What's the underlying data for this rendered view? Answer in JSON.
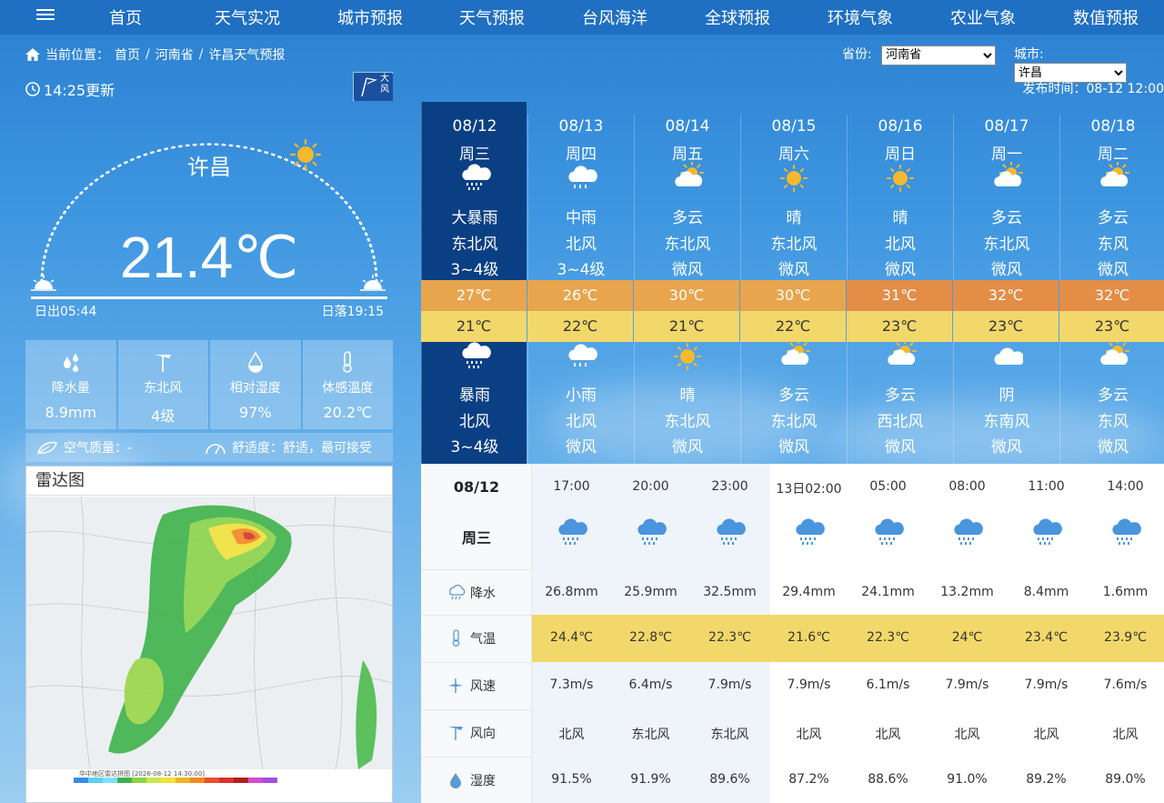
{
  "nav": {
    "items": [
      "首页",
      "天气实况",
      "城市预报",
      "天气预报",
      "台风海洋",
      "全球预报",
      "环境气象",
      "农业气象",
      "数值预报"
    ]
  },
  "breadcrumb": {
    "label": "当前位置：",
    "items": [
      "首页",
      "河南省",
      "许昌天气预报"
    ]
  },
  "selectors": {
    "province_label": "省份:",
    "province_value": "河南省",
    "city_label": "城市:",
    "city_value": "许昌"
  },
  "update_time": "14:25更新",
  "publish_time": "发布时间：08-12 12:00",
  "warning_badge": "大风",
  "current": {
    "city": "许昌",
    "temperature": "21.4℃",
    "sunrise": "日出05:44",
    "sunset": "日落19:15",
    "stats": [
      {
        "icon": "raindrop-icon",
        "label": "降水量",
        "value": "8.9mm"
      },
      {
        "icon": "wind-icon",
        "label": "东北风",
        "value": "4级"
      },
      {
        "icon": "humidity-icon",
        "label": "相对湿度",
        "value": "97%"
      },
      {
        "icon": "thermometer-icon",
        "label": "体感温度",
        "value": "20.2℃"
      }
    ],
    "air_quality": "空气质量：-",
    "comfort": "舒适度：舒适，最可接受"
  },
  "radar": {
    "title": "雷达图",
    "footer": "华中地区雷达拼图 [2026-08-12 14:30:00]"
  },
  "week": [
    {
      "date": "08/12",
      "weekday": "周三",
      "day_icon": "heavy-rain-icon",
      "day_weather": "大暴雨",
      "day_wind": "东北风",
      "day_level": "3~4级",
      "high": "27℃",
      "low": "21℃",
      "night_icon": "heavy-rain-icon",
      "night_weather": "暴雨",
      "night_wind": "北风",
      "night_level": "3~4级"
    },
    {
      "date": "08/13",
      "weekday": "周四",
      "day_icon": "rain-icon",
      "day_weather": "中雨",
      "day_wind": "北风",
      "day_level": "3~4级",
      "high": "26℃",
      "low": "22℃",
      "night_icon": "rain-icon",
      "night_weather": "小雨",
      "night_wind": "北风",
      "night_level": "微风"
    },
    {
      "date": "08/14",
      "weekday": "周五",
      "day_icon": "partly-cloudy-icon",
      "day_weather": "多云",
      "day_wind": "东北风",
      "day_level": "微风",
      "high": "30℃",
      "low": "21℃",
      "night_icon": "sun-icon",
      "night_weather": "晴",
      "night_wind": "东北风",
      "night_level": "微风"
    },
    {
      "date": "08/15",
      "weekday": "周六",
      "day_icon": "sun-icon",
      "day_weather": "晴",
      "day_wind": "东北风",
      "day_level": "微风",
      "high": "30℃",
      "low": "22℃",
      "night_icon": "partly-cloudy-icon",
      "night_weather": "多云",
      "night_wind": "东北风",
      "night_level": "微风"
    },
    {
      "date": "08/16",
      "weekday": "周日",
      "day_icon": "sun-icon",
      "day_weather": "晴",
      "day_wind": "北风",
      "day_level": "微风",
      "high": "31℃",
      "low": "23℃",
      "night_icon": "partly-cloudy-icon",
      "night_weather": "多云",
      "night_wind": "西北风",
      "night_level": "微风"
    },
    {
      "date": "08/17",
      "weekday": "周一",
      "day_icon": "partly-cloudy-icon",
      "day_weather": "多云",
      "day_wind": "东北风",
      "day_level": "微风",
      "high": "32℃",
      "low": "23℃",
      "night_icon": "overcast-icon",
      "night_weather": "阴",
      "night_wind": "东南风",
      "night_level": "微风"
    },
    {
      "date": "08/18",
      "weekday": "周二",
      "day_icon": "partly-cloudy-icon",
      "day_weather": "多云",
      "day_wind": "东风",
      "day_level": "微风",
      "high": "32℃",
      "low": "23℃",
      "night_icon": "partly-cloudy-icon",
      "night_weather": "多云",
      "night_wind": "东风",
      "night_level": "微风"
    }
  ],
  "high_colors": [
    "#e8a54e",
    "#e8a54e",
    "#e8a54e",
    "#e8a54e",
    "#e38d47",
    "#e38d47",
    "#e38d47"
  ],
  "hourly": {
    "date": "08/12",
    "weekday": "周三",
    "row_labels": [
      "降水",
      "气温",
      "风速",
      "风向",
      "湿度"
    ],
    "times": [
      "17:00",
      "20:00",
      "23:00",
      "13日02:00",
      "05:00",
      "08:00",
      "11:00",
      "14:00"
    ],
    "precip": [
      "26.8mm",
      "25.9mm",
      "32.5mm",
      "29.4mm",
      "24.1mm",
      "13.2mm",
      "8.4mm",
      "1.6mm"
    ],
    "temp": [
      "24.4℃",
      "22.8℃",
      "22.3℃",
      "21.6℃",
      "22.3℃",
      "24℃",
      "23.4℃",
      "23.9℃"
    ],
    "wind_speed": [
      "7.3m/s",
      "6.4m/s",
      "7.9m/s",
      "7.9m/s",
      "6.1m/s",
      "7.9m/s",
      "7.9m/s",
      "7.6m/s"
    ],
    "wind_dir": [
      "北风",
      "东北风",
      "东北风",
      "北风",
      "北风",
      "北风",
      "北风",
      "北风"
    ],
    "humidity": [
      "91.5%",
      "91.9%",
      "89.6%",
      "87.2%",
      "88.6%",
      "91.0%",
      "89.2%",
      "89.0%"
    ]
  },
  "colors": {
    "nav_bg": "#1f6fc2",
    "today_bg": "#0b3f84",
    "low_band": "#f2d86a",
    "temp_band": "#f2d86a"
  }
}
